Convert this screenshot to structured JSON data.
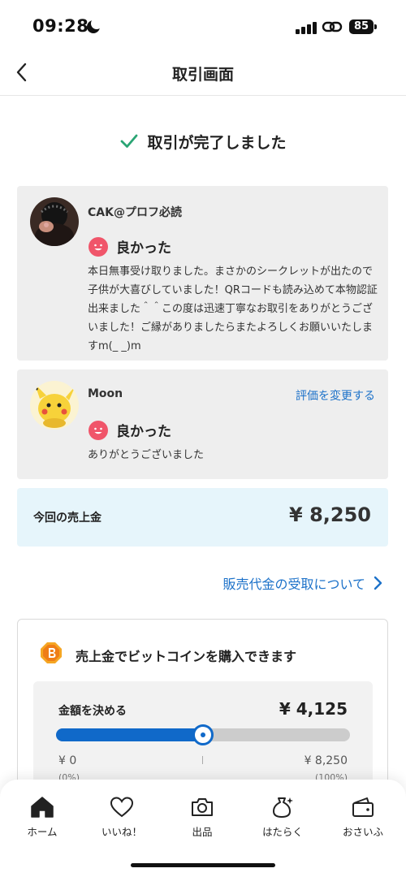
{
  "status_bar": {
    "time": "09:28",
    "battery": "85"
  },
  "nav": {
    "title": "取引画面"
  },
  "completion": {
    "text": "取引が完了しました"
  },
  "reviews": [
    {
      "user_name": "CAK@プロフ必読",
      "rating": "良かった",
      "text": "本日無事受け取りました。まさかのシークレットが出たので子供が大喜びしていました！QRコードも読み込めて本物認証出来ました＾＾この度は迅速丁寧なお取引をありがとうございました！ご縁がありましたらまたよろしくお願いいたしますm(_ _)m"
    },
    {
      "user_name": "Moon",
      "rating": "良かった",
      "text": "ありがとうございました",
      "change_link": "評価を変更する"
    }
  ],
  "sales": {
    "label": "今回の売上金",
    "amount": "¥ 8,250"
  },
  "receive_link": "販売代金の受取について",
  "bitcoin": {
    "title": "売上金でビットコインを購入できます",
    "amount_label": "金額を決める",
    "amount_value": "¥ 4,125",
    "slider_fraction": 0.5,
    "min_value": "¥ 0",
    "min_pct": "(0%)",
    "max_value": "¥ 8,250",
    "max_pct": "(100%)"
  },
  "tabs": [
    {
      "label": "ホーム",
      "icon": "home-icon"
    },
    {
      "label": "いいね！",
      "icon": "heart-icon"
    },
    {
      "label": "出品",
      "icon": "camera-icon"
    },
    {
      "label": "はたらく",
      "icon": "money-bag-icon"
    },
    {
      "label": "おさいふ",
      "icon": "wallet-icon"
    }
  ],
  "colors": {
    "accent_blue": "#1d72c9",
    "check_green": "#2aa574",
    "rating_pink": "#f0556a",
    "sales_bg": "#e6f5fb"
  }
}
